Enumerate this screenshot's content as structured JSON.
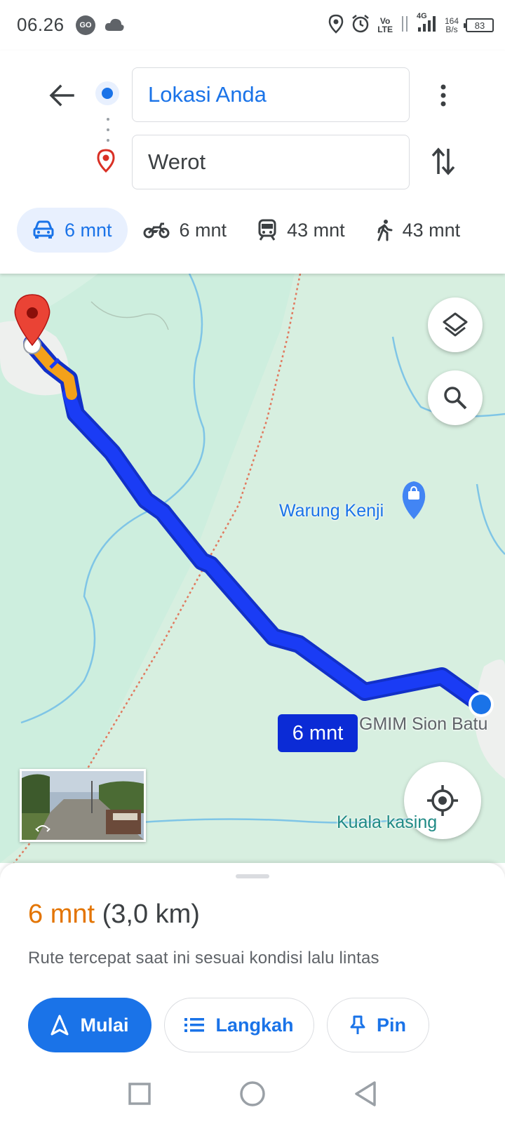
{
  "status_bar": {
    "time": "06.26",
    "app_badge": "GO",
    "volte_top": "Vo",
    "volte_bottom": "LTE",
    "network_type": "4G",
    "speed_value": "164",
    "speed_unit": "B/s",
    "battery": "83"
  },
  "directions": {
    "origin": "Lokasi Anda",
    "destination": "Werot",
    "origin_color": "#1a73e8",
    "destination_icon": "red-location-pin-icon"
  },
  "travel_modes": [
    {
      "mode": "driving",
      "icon": "car-icon",
      "duration": "6 mnt",
      "selected": true
    },
    {
      "mode": "motorcycle",
      "icon": "motorcycle-icon",
      "duration": "6 mnt",
      "selected": false
    },
    {
      "mode": "transit",
      "icon": "train-icon",
      "duration": "43 mnt",
      "selected": false
    },
    {
      "mode": "walking",
      "icon": "walking-icon",
      "duration": "43 mnt",
      "selected": false
    }
  ],
  "map": {
    "route_time_callout": "6 mnt",
    "labels": {
      "warung": "Warung Kenji",
      "gmim": "GMIM Sion Batu",
      "kuala": "Kuala kasing"
    },
    "route_color": "#1a3cf5",
    "traffic_color": "#f4a11a"
  },
  "summary": {
    "duration": "6 mnt",
    "distance": "(3,0 km)",
    "description": "Rute tercepat saat ini sesuai kondisi lalu lintas"
  },
  "actions": {
    "start": "Mulai",
    "steps": "Langkah",
    "pin": "Pin"
  }
}
